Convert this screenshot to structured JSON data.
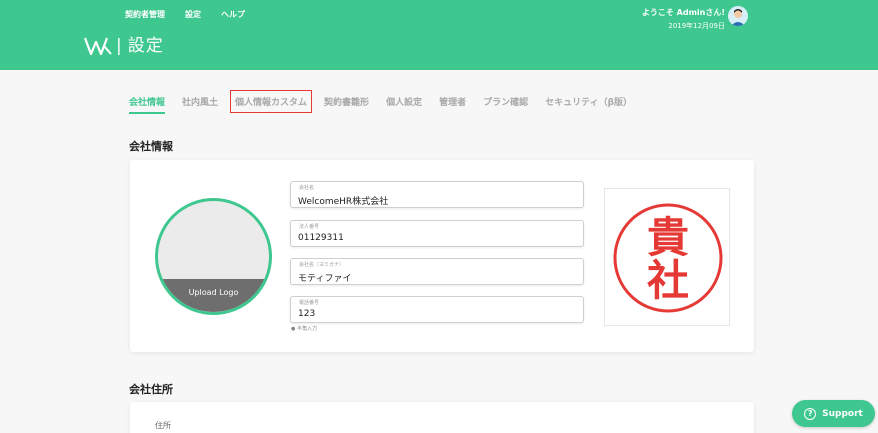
{
  "topnav": {
    "items": [
      {
        "label": "契約者管理"
      },
      {
        "label": "設定"
      },
      {
        "label": "ヘルプ"
      }
    ]
  },
  "header": {
    "title": "設定",
    "separator": "|",
    "welcome": "ようこそ Adminさん!",
    "date": "2019年12月09日"
  },
  "tabs": [
    {
      "label": "会社情報",
      "active": true
    },
    {
      "label": "社内風土"
    },
    {
      "label": "個人情報カスタム",
      "highlighted": true
    },
    {
      "label": "契約書雛形"
    },
    {
      "label": "個人設定"
    },
    {
      "label": "管理者"
    },
    {
      "label": "プラン確認"
    },
    {
      "label": "セキュリティ（β版）"
    }
  ],
  "company_info": {
    "section_title": "会社情報",
    "upload_logo": "Upload Logo",
    "fields": [
      {
        "label": "会社名",
        "value": "WelcomeHR株式会社"
      },
      {
        "label": "法人番号",
        "value": "01129311"
      },
      {
        "label": "会社名（ヨミガナ）",
        "value": "モティファイ"
      },
      {
        "label": "電話番号",
        "value": "123"
      }
    ],
    "hint": "● 半角入力",
    "seal_text": "貴社"
  },
  "address": {
    "section_title": "会社住所",
    "label": "住所"
  },
  "support": {
    "label": "Support",
    "icon": "?"
  },
  "colors": {
    "brand": "#3ec78f",
    "highlight": "#e53935",
    "seal": "#e53935"
  }
}
